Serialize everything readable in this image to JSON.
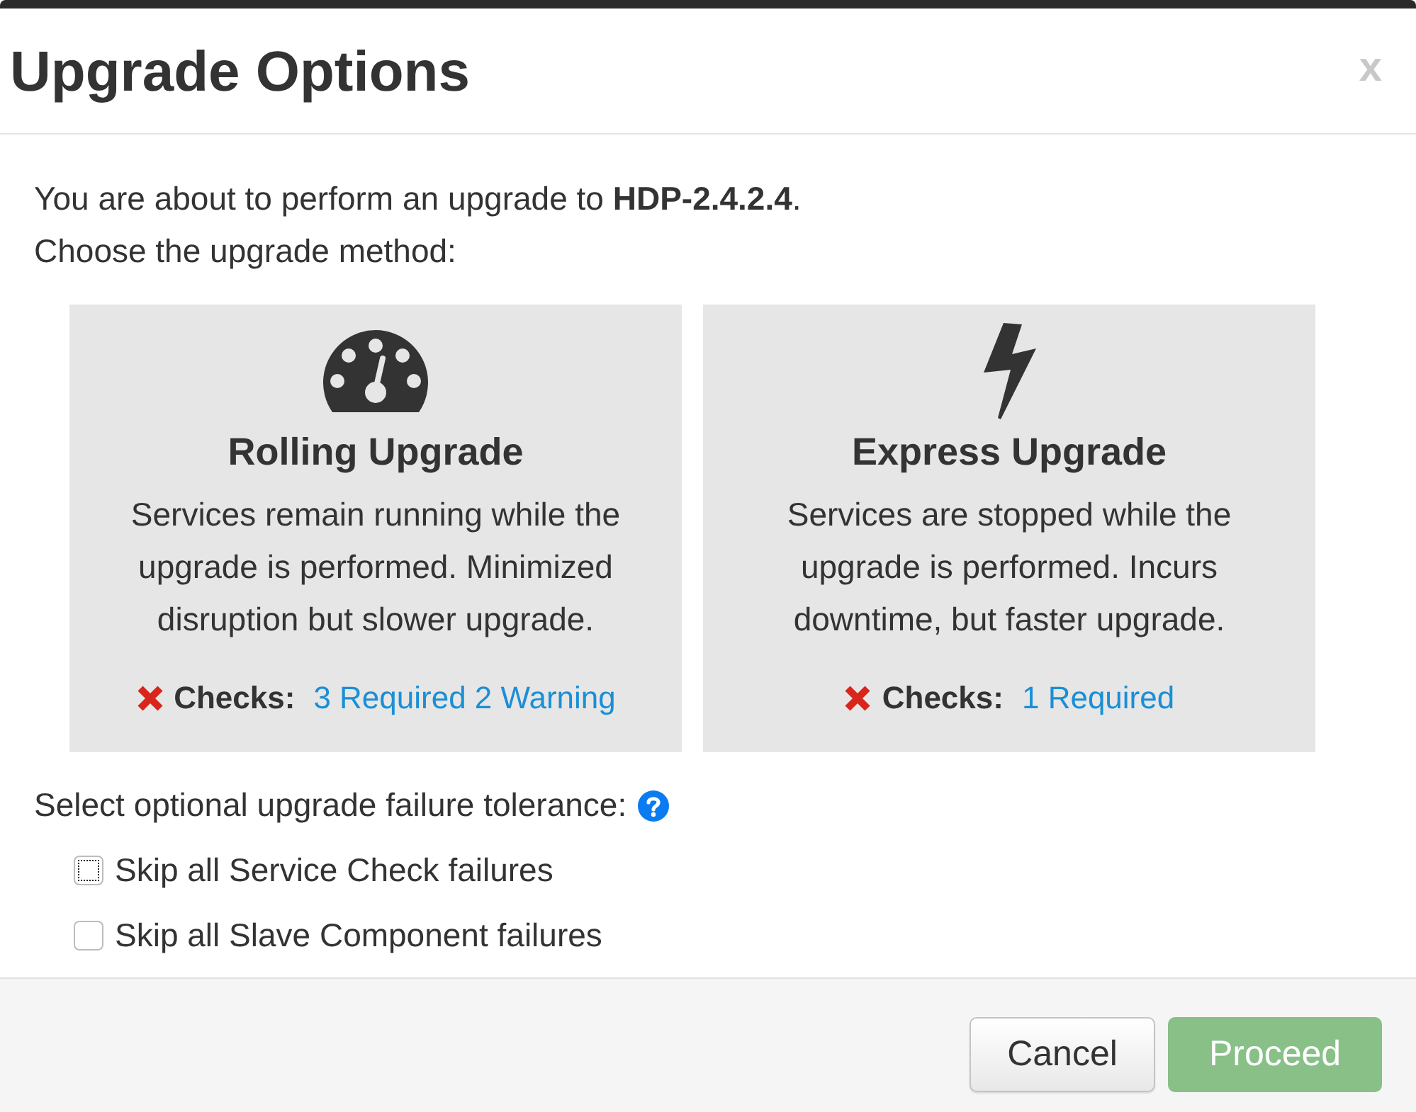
{
  "dialog": {
    "title": "Upgrade Options",
    "close_label": "x"
  },
  "intro": {
    "line_1": "You are about to perform an upgrade to **HDP-2.4.2.4**.",
    "line_2": "Choose the upgrade method:"
  },
  "methods": [
    {
      "kind": "gauge",
      "title": "Rolling Upgrade",
      "description": "Services remain running while the upgrade is performed. Minimized disruption but slower upgrade.",
      "selected": false,
      "checks_passed": false,
      "checks_label": "Checks:",
      "checks_link": "3 Required 2 Warning"
    },
    {
      "kind": "bolt",
      "title": "Express Upgrade",
      "description": "Services are stopped while the upgrade is performed. Incurs downtime, but faster upgrade.",
      "selected": false,
      "checks_passed": false,
      "checks_label": "Checks:",
      "checks_link": "1 Required"
    }
  ],
  "tolerance": {
    "label": "Select optional upgrade failure tolerance:",
    "options": [
      {
        "label": "Skip all Service Check failures",
        "checked": false,
        "focused": true
      },
      {
        "label": "Skip all Slave Component failures",
        "checked": false,
        "focused": false
      }
    ]
  },
  "buttons": [
    {
      "kind": "default",
      "label": "Cancel",
      "disabled": false
    },
    {
      "kind": "primary",
      "label": "Proceed",
      "disabled": true
    }
  ]
}
